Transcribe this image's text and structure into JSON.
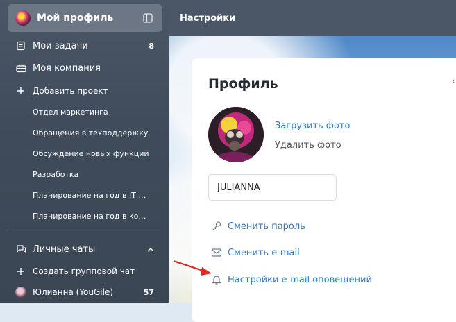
{
  "sidebar": {
    "profile": {
      "label": "Мой профиль"
    },
    "items": [
      {
        "label": "Мои задачи",
        "count": "8"
      },
      {
        "label": "Моя компания"
      },
      {
        "label": "Добавить проект"
      }
    ],
    "projects": [
      "Отдел маркетинга",
      "Обращения в техподдержку",
      "Обсуждение новых функций",
      "Разработка",
      "Планирование на год в IT ко...",
      "Планирование на год в кома..."
    ],
    "chats_header": "Личные чаты",
    "create_chat": "Создать групповой чат",
    "chat_user": {
      "label": "Юлианна (YouGile)",
      "count": "57"
    }
  },
  "header": {
    "title": "Настройки"
  },
  "profile_card": {
    "title": "Профиль",
    "upload_photo": "Загрузить фото",
    "delete_photo": "Удалить фото",
    "name_value": "JULIANNA",
    "change_password": "Сменить пароль",
    "change_email": "Сменить e-mail",
    "email_notifications": "Настройки e-mail оповещений"
  },
  "colors": {
    "sidebar": "#4b5666",
    "link": "#2f79c8",
    "arrow": "#e02424"
  }
}
